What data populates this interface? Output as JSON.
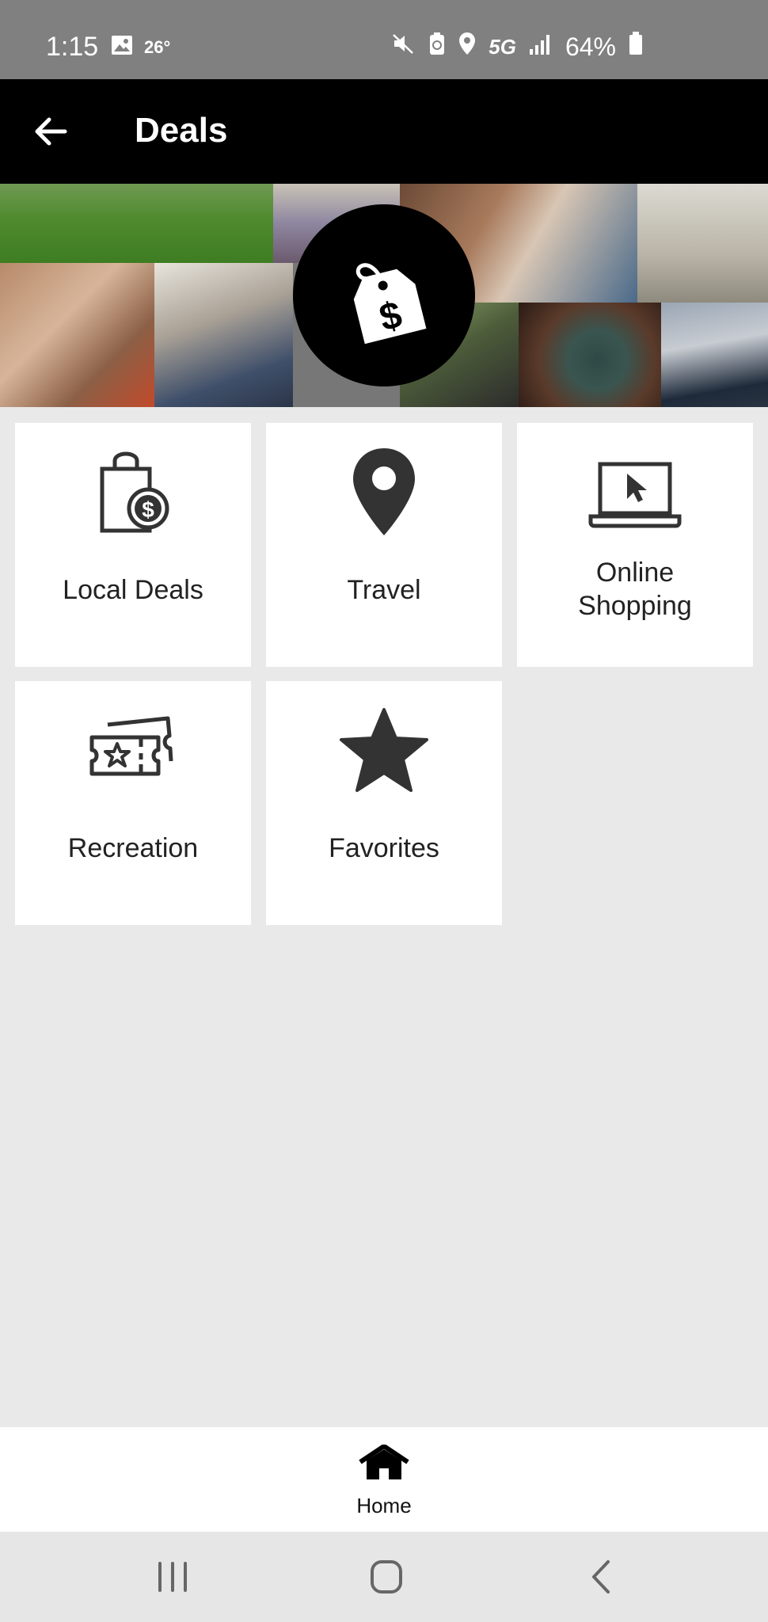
{
  "status_bar": {
    "time": "1:15",
    "temperature": "26°",
    "network": "5G",
    "battery": "64%"
  },
  "app_bar": {
    "title": "Deals"
  },
  "categories": [
    {
      "label": "Local Deals",
      "icon": "shopping-bag-dollar-icon"
    },
    {
      "label": "Travel",
      "icon": "map-pin-icon"
    },
    {
      "label": "Online Shopping",
      "label_line1": "Online",
      "label_line2": "Shopping",
      "icon": "laptop-cursor-icon"
    },
    {
      "label": "Recreation",
      "icon": "ticket-star-icon"
    },
    {
      "label": "Favorites",
      "icon": "star-icon"
    }
  ],
  "bottom_nav": {
    "home_label": "Home"
  },
  "colors": {
    "status_bar": "#808080",
    "app_bar": "#000000",
    "background": "#e9e9e9",
    "card": "#ffffff",
    "icon": "#333333"
  }
}
